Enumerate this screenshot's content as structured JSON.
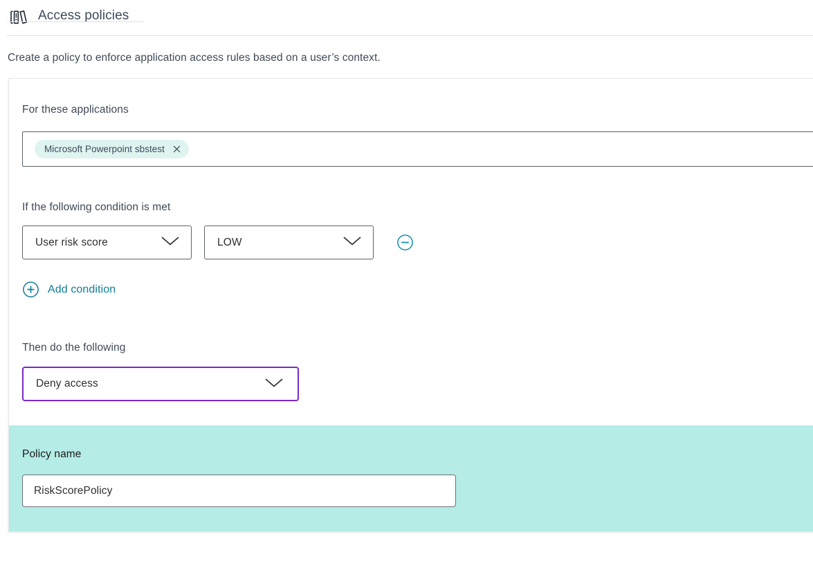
{
  "header": {
    "icon": "books-icon",
    "title": "Access policies"
  },
  "intro": "Create a policy to enforce application access rules based on a user’s context.",
  "applications": {
    "label": "For these applications",
    "chips": [
      {
        "label": "Microsoft Powerpoint sbstest",
        "close_icon": "close-icon"
      }
    ]
  },
  "condition": {
    "label": "If the following condition is met",
    "type_select": {
      "value": "User risk score",
      "chevron_icon": "chevron-down-icon"
    },
    "value_select": {
      "value": "LOW",
      "chevron_icon": "chevron-down-icon"
    },
    "remove_icon": "minus-circle-icon",
    "add_condition": {
      "icon": "plus-circle-icon",
      "label": "Add condition"
    }
  },
  "action": {
    "label": "Then do the following",
    "select": {
      "value": "Deny access",
      "chevron_icon": "chevron-down-icon"
    }
  },
  "policy": {
    "label": "Policy name",
    "input_value": "RiskScorePolicy"
  },
  "colors": {
    "accent_teal": "#0e7d99",
    "chip_bg": "#dff4f1",
    "band_bg": "#b5ece6",
    "focus_purple": "#7b27c9",
    "text": "#3e4957"
  }
}
